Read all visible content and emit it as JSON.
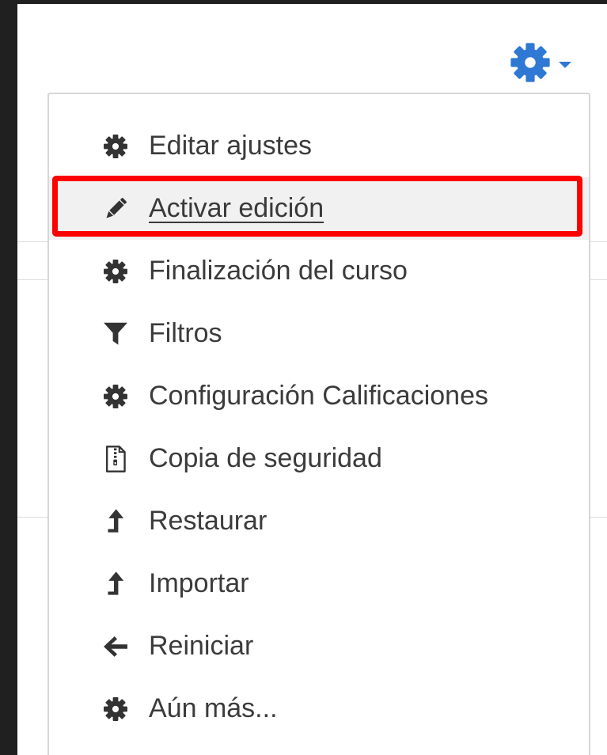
{
  "colors": {
    "accent": "#2f79d4",
    "highlight": "#ff0000",
    "text": "#3b3b3b"
  },
  "toggle": {
    "icon": "gear-icon"
  },
  "menu": {
    "items": [
      {
        "label": "Editar ajustes",
        "icon": "gear-icon"
      },
      {
        "label": "Activar edición",
        "icon": "pencil-icon"
      },
      {
        "label": "Finalización del curso",
        "icon": "gear-icon"
      },
      {
        "label": "Filtros",
        "icon": "filter-icon"
      },
      {
        "label": "Configuración Calificaciones",
        "icon": "gear-icon"
      },
      {
        "label": "Copia de seguridad",
        "icon": "zip-file-icon"
      },
      {
        "label": "Restaurar",
        "icon": "upload-arrow-icon"
      },
      {
        "label": "Importar",
        "icon": "upload-arrow-icon"
      },
      {
        "label": "Reiniciar",
        "icon": "arrow-left-icon"
      },
      {
        "label": "Aún más...",
        "icon": "gear-icon"
      }
    ]
  }
}
